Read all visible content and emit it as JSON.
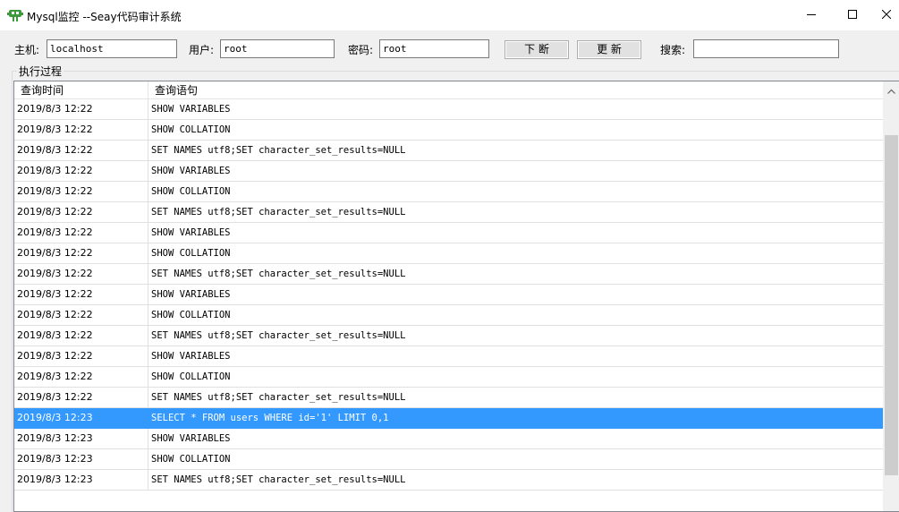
{
  "window": {
    "title": "Mysql监控 --Seay代码审计系统"
  },
  "toolbar": {
    "host_label": "主机:",
    "host_value": "localhost",
    "user_label": "用户:",
    "user_value": "root",
    "password_label": "密码:",
    "password_value": "root",
    "interrupt_button": "下 断",
    "refresh_button": "更 新",
    "search_label": "搜索:",
    "search_value": ""
  },
  "group": {
    "label": "执行过程"
  },
  "list": {
    "columns": [
      "查询时间",
      "查询语句"
    ],
    "selected_index": 15,
    "rows": [
      {
        "time": "2019/8/3 12:22",
        "query": "SHOW VARIABLES"
      },
      {
        "time": "2019/8/3 12:22",
        "query": "SHOW COLLATION"
      },
      {
        "time": "2019/8/3 12:22",
        "query": "SET NAMES utf8;SET character_set_results=NULL"
      },
      {
        "time": "2019/8/3 12:22",
        "query": "SHOW VARIABLES"
      },
      {
        "time": "2019/8/3 12:22",
        "query": "SHOW COLLATION"
      },
      {
        "time": "2019/8/3 12:22",
        "query": "SET NAMES utf8;SET character_set_results=NULL"
      },
      {
        "time": "2019/8/3 12:22",
        "query": "SHOW VARIABLES"
      },
      {
        "time": "2019/8/3 12:22",
        "query": "SHOW COLLATION"
      },
      {
        "time": "2019/8/3 12:22",
        "query": "SET NAMES utf8;SET character_set_results=NULL"
      },
      {
        "time": "2019/8/3 12:22",
        "query": "SHOW VARIABLES"
      },
      {
        "time": "2019/8/3 12:22",
        "query": "SHOW COLLATION"
      },
      {
        "time": "2019/8/3 12:22",
        "query": "SET NAMES utf8;SET character_set_results=NULL"
      },
      {
        "time": "2019/8/3 12:22",
        "query": "SHOW VARIABLES"
      },
      {
        "time": "2019/8/3 12:22",
        "query": "SHOW COLLATION"
      },
      {
        "time": "2019/8/3 12:22",
        "query": "SET NAMES utf8;SET character_set_results=NULL"
      },
      {
        "time": "2019/8/3 12:23",
        "query": "SELECT * FROM users WHERE id='1' LIMIT 0,1"
      },
      {
        "time": "2019/8/3 12:23",
        "query": "SHOW VARIABLES"
      },
      {
        "time": "2019/8/3 12:23",
        "query": "SHOW COLLATION"
      },
      {
        "time": "2019/8/3 12:23",
        "query": "SET NAMES utf8;SET character_set_results=NULL"
      }
    ]
  },
  "colors": {
    "selection": "#3399ff",
    "icon_green": "#3c9a3c"
  },
  "icons": {
    "app": "app-icon",
    "minimize": "minimize-icon",
    "maximize": "maximize-icon",
    "close": "close-icon",
    "scroll_up": "chevron-up-icon"
  }
}
